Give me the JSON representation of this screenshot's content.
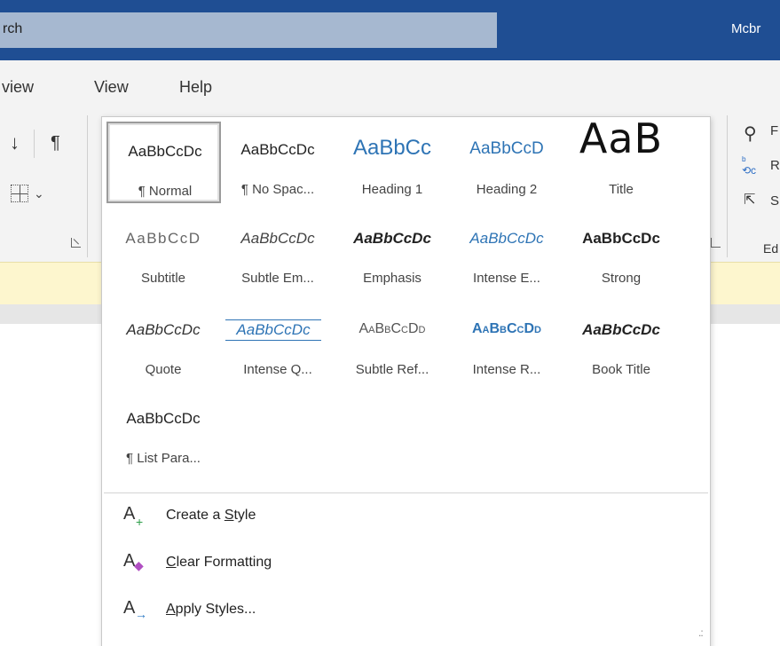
{
  "titlebar": {
    "search_text": "rch",
    "username": "Mcbr"
  },
  "tabs": [
    {
      "label": "view"
    },
    {
      "label": "View"
    },
    {
      "label": "Help"
    }
  ],
  "ribbon": {
    "editing": {
      "find": "F",
      "replace": "R",
      "select": "S",
      "group_label": "Ed"
    }
  },
  "styles_gallery": {
    "items": [
      {
        "preview": "AaBbCcDc",
        "name": "¶ Normal",
        "selected": true
      },
      {
        "preview": "AaBbCcDc",
        "name": "¶ No Spac..."
      },
      {
        "preview": "AaBbCc",
        "name": "Heading 1"
      },
      {
        "preview": "AaBbCcD",
        "name": "Heading 2"
      },
      {
        "preview": "AaB",
        "name": "Title"
      },
      {
        "preview": "AaBbCcD",
        "name": "Subtitle"
      },
      {
        "preview": "AaBbCcDc",
        "name": "Subtle Em..."
      },
      {
        "preview": "AaBbCcDc",
        "name": "Emphasis"
      },
      {
        "preview": "AaBbCcDc",
        "name": "Intense E..."
      },
      {
        "preview": "AaBbCcDc",
        "name": "Strong"
      },
      {
        "preview": "AaBbCcDc",
        "name": "Quote"
      },
      {
        "preview": "AaBbCcDc",
        "name": "Intense Q..."
      },
      {
        "preview": "AaBbCcDd",
        "name": "Subtle Ref..."
      },
      {
        "preview": "AaBbCcDd",
        "name": "Intense R..."
      },
      {
        "preview": "AaBbCcDc",
        "name": "Book Title"
      },
      {
        "preview": "AaBbCcDc",
        "name": "¶ List Para..."
      }
    ],
    "menu": [
      {
        "icon": "create-style-icon",
        "label": "Create a Style",
        "mnemonic": "S"
      },
      {
        "icon": "clear-formatting-icon",
        "label": "Clear Formatting",
        "mnemonic": "C"
      },
      {
        "icon": "apply-styles-icon",
        "label": "Apply Styles...",
        "mnemonic": "A"
      }
    ]
  },
  "colors": {
    "titlebar": "#1f4e93",
    "heading_blue": "#2e74b5",
    "message_bar": "#fdf6ce"
  }
}
